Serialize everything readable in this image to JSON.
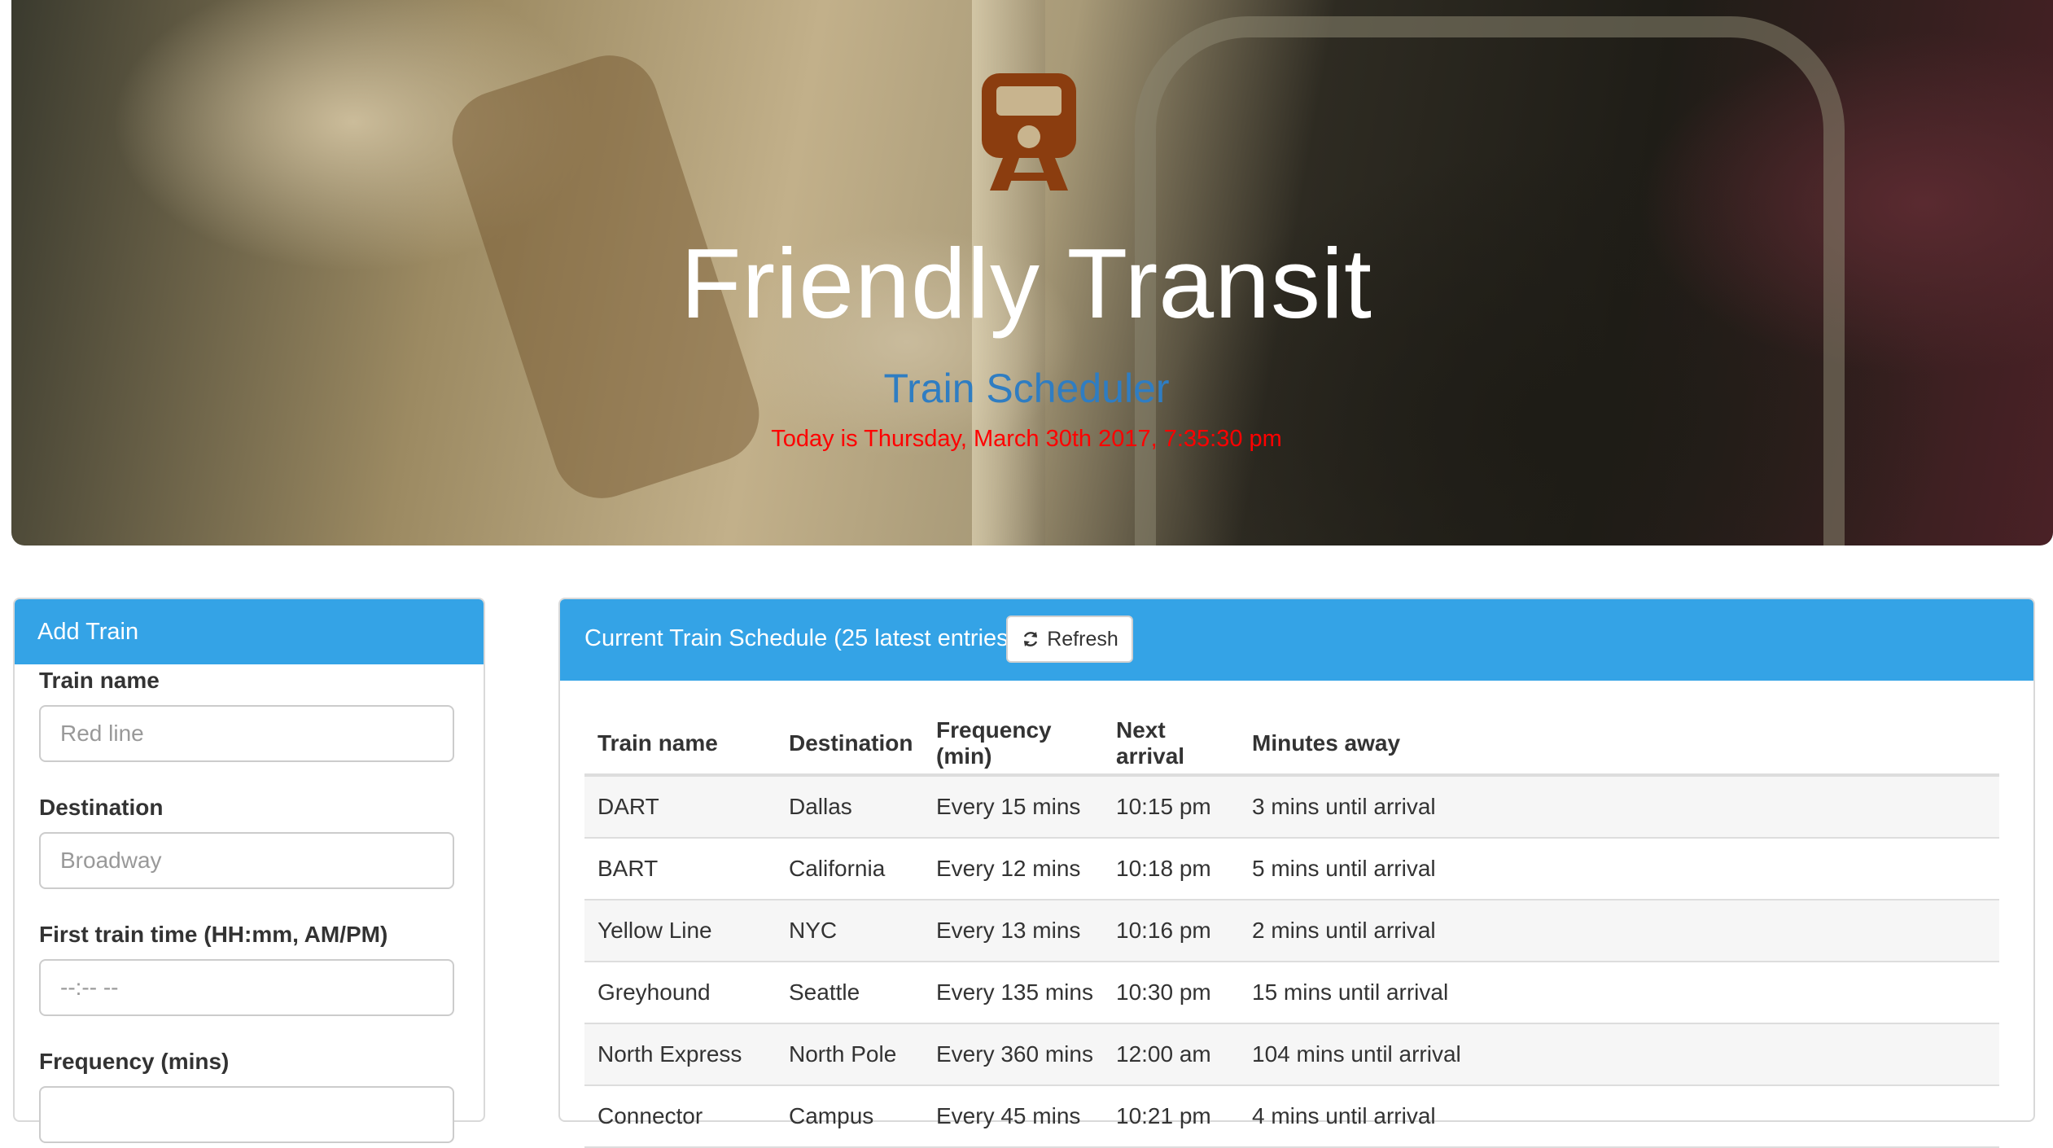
{
  "header": {
    "title": "Friendly Transit",
    "subtitle": "Train Scheduler",
    "datetime": "Today is Thursday, March 30th 2017, 7:35:30 pm",
    "icon": "train-icon",
    "icon_color": "#8b3d0f"
  },
  "add_train": {
    "heading": "Add Train",
    "fields": [
      {
        "label": "Train name",
        "placeholder": "Red line"
      },
      {
        "label": "Destination",
        "placeholder": "Broadway"
      },
      {
        "label": "First train time (HH:mm, AM/PM)",
        "placeholder": "--:-- --"
      },
      {
        "label": "Frequency (mins)",
        "placeholder": ""
      }
    ]
  },
  "schedule": {
    "heading": "Current Train Schedule (25 latest entries)",
    "refresh_label": "Refresh",
    "columns": [
      "Train name",
      "Destination",
      "Frequency (min)",
      "Next arrival",
      "Minutes away"
    ],
    "rows": [
      [
        "DART",
        "Dallas",
        "Every 15 mins",
        "10:15 pm",
        "3 mins until arrival"
      ],
      [
        "BART",
        "California",
        "Every 12 mins",
        "10:18 pm",
        "5 mins until arrival"
      ],
      [
        "Yellow Line",
        "NYC",
        "Every 13 mins",
        "10:16 pm",
        "2 mins until arrival"
      ],
      [
        "Greyhound",
        "Seattle",
        "Every 135 mins",
        "10:30 pm",
        "15 mins until arrival"
      ],
      [
        "North Express",
        "North Pole",
        "Every 360 mins",
        "12:00 am",
        "104 mins until arrival"
      ],
      [
        "Connector",
        "Campus",
        "Every 45 mins",
        "10:21 pm",
        "4 mins until arrival"
      ]
    ]
  },
  "colors": {
    "panel_header": "#34a3e6",
    "subtitle": "#2f7dc2",
    "datetime": "#ff0000"
  }
}
